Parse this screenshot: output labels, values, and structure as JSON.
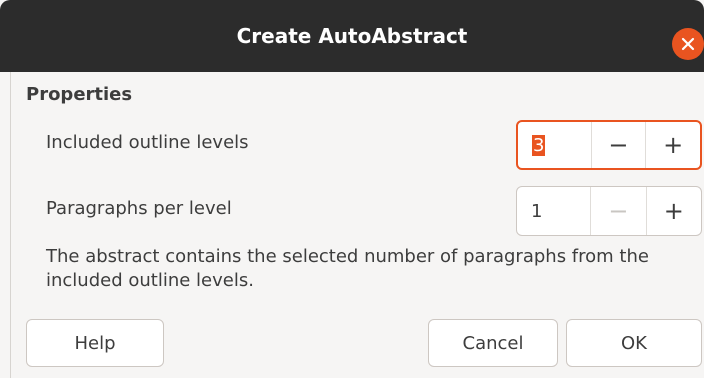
{
  "dialog": {
    "title": "Create AutoAbstract"
  },
  "properties": {
    "heading": "Properties",
    "included_outline_levels": {
      "label": "Included outline levels",
      "value": "3",
      "decrement": "−",
      "increment": "+"
    },
    "paragraphs_per_level": {
      "label": "Paragraphs per level",
      "value": "1",
      "decrement": "−",
      "increment": "+"
    },
    "description": "The abstract contains the selected number of paragraphs from the included outline levels."
  },
  "buttons": {
    "help": "Help",
    "cancel": "Cancel",
    "ok": "OK"
  },
  "colors": {
    "accent": "#e95420",
    "titlebar": "#2c2c2c",
    "background": "#f6f5f4"
  }
}
